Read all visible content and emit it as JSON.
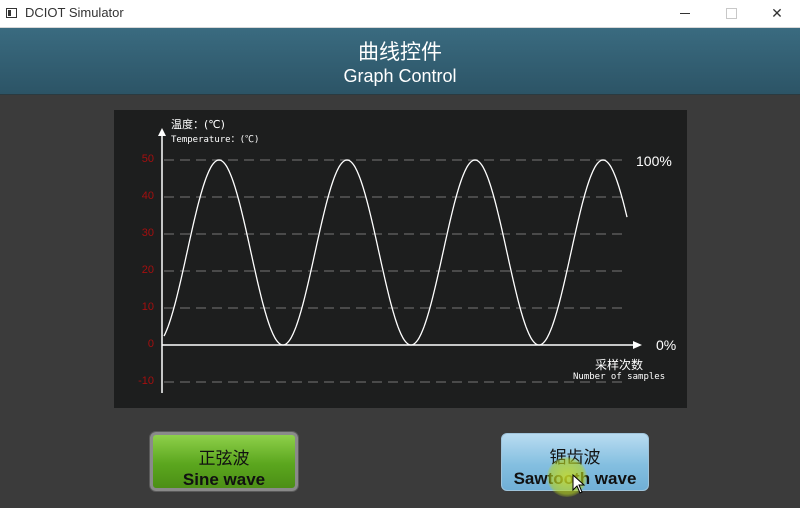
{
  "window": {
    "title": "DCIOT Simulator",
    "minimize_icon": "minimize-icon",
    "maximize_icon": "maximize-icon",
    "close_icon": "close-icon",
    "close_glyph": "✕"
  },
  "header": {
    "title_cn": "曲线控件",
    "title_en": "Graph Control"
  },
  "graph": {
    "y_title_cn": "温度：(℃)",
    "y_title_en": "Temperature：(℃)",
    "x_title_cn": "采样次数",
    "x_title_en": "Number of samples",
    "max_label": "100%",
    "min_label": "0%",
    "colors": {
      "tick": "#a40f0f",
      "grid": "#4a4a4a",
      "curve": "#ffffff"
    }
  },
  "chart_data": {
    "type": "line",
    "title": "",
    "xlabel": "采样次数 Number of samples",
    "ylabel": "温度：(℃) Temperature：(℃)",
    "y_ticks": [
      "50",
      "40",
      "30",
      "20",
      "10",
      "0",
      "-10"
    ],
    "ylim": [
      -10,
      50
    ],
    "grid": "dashed horizontal",
    "series": [
      {
        "shape": "sine",
        "amplitude_pct": [
          0,
          100
        ],
        "y_min": 0,
        "y_max": 50,
        "cycles_visible": 3.5,
        "x": [
          0,
          12.5,
          25,
          37.5,
          50,
          62.5,
          75,
          87.5,
          100,
          112.5,
          125,
          137.5,
          150,
          162.5,
          175
        ],
        "values": [
          0,
          25,
          50,
          25,
          0,
          25,
          50,
          25,
          0,
          25,
          50,
          25,
          0,
          25,
          50
        ]
      }
    ]
  },
  "buttons": {
    "sine": {
      "label_cn": "正弦波",
      "label_en": "Sine wave"
    },
    "sawtooth": {
      "label_cn": "锯齿波",
      "label_en": "Sawtooth wave"
    }
  }
}
